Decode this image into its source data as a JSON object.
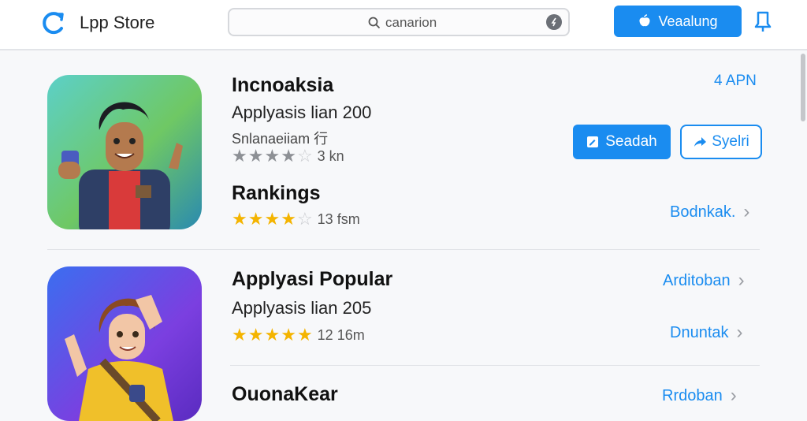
{
  "header": {
    "app_title": "Lpp Store",
    "search_text": "canarion",
    "primary_button": "Veaalung"
  },
  "apps": [
    {
      "title": "Incnoaksia",
      "subtitle": "Applyasis lian 200",
      "developer": "Snlanaeiiam ⾏",
      "rating_text": "3 kn",
      "rating_stars": 3.5,
      "meta": "4 APN",
      "primary_button": "Seadah",
      "secondary_button": "Syelri"
    },
    {
      "title": "Rankings",
      "rating_text": "13 fsm",
      "rating_stars": 4,
      "link": "Bodnkak."
    },
    {
      "title": "Applyasi Popular",
      "subtitle": "Applyasis lian 205",
      "link": "Arditoban"
    },
    {
      "rating_text": "12 16m",
      "rating_stars": 5,
      "link": "Dnuntak"
    },
    {
      "title": "OuonaKear",
      "link": "Rrdoban"
    }
  ],
  "colors": {
    "accent": "#1a8cf0",
    "star": "#f4b400"
  }
}
